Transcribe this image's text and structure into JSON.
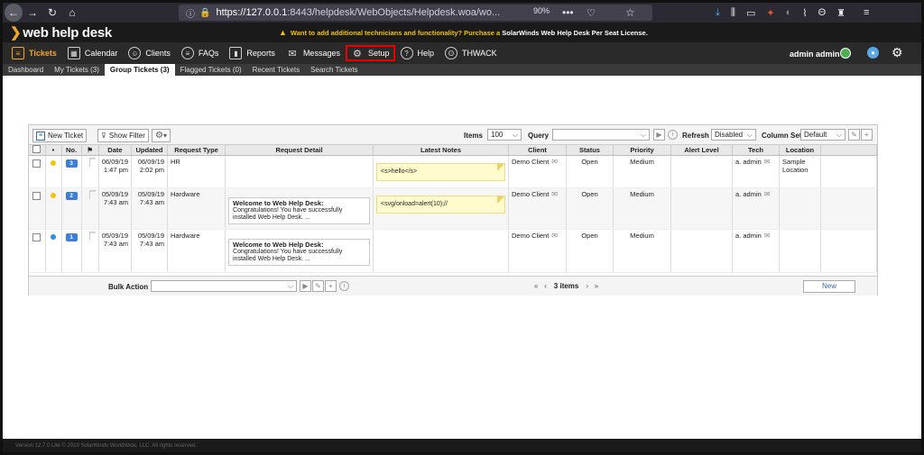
{
  "browser": {
    "url_host": "https://127.0.0.1",
    "url_rest": ":8443/helpdesk/WebObjects/Helpdesk.woa/wo...",
    "zoom": "90%"
  },
  "app": {
    "logo": "web help desk",
    "promo_text": "Want to add additional technicians and functionality? Purchase a",
    "promo_strong": "SolarWinds Web Help Desk Per Seat License."
  },
  "main_nav": {
    "items": [
      {
        "label": "Tickets",
        "icon": "list-icon"
      },
      {
        "label": "Calendar",
        "icon": "calendar-icon"
      },
      {
        "label": "Clients",
        "icon": "person-icon"
      },
      {
        "label": "FAQs",
        "icon": "faq-icon"
      },
      {
        "label": "Reports",
        "icon": "chart-icon"
      },
      {
        "label": "Messages",
        "icon": "mail-icon"
      },
      {
        "label": "Setup",
        "icon": "gear-icon"
      },
      {
        "label": "Help",
        "icon": "help-icon"
      },
      {
        "label": "THWACK",
        "icon": "thwack-icon"
      }
    ],
    "admin_label": "admin admin"
  },
  "sub_nav": {
    "tabs": [
      "Dashboard",
      "My Tickets (3)",
      "Group Tickets (3)",
      "Flagged Tickets (0)",
      "Recent Tickets",
      "Search Tickets"
    ]
  },
  "toolbar": {
    "new_ticket": "New Ticket",
    "show_filter": "Show Filter",
    "items_label": "Items",
    "items_value": "100",
    "query_label": "Query",
    "refresh_label": "Refresh",
    "refresh_value": "Disabled",
    "column_set_label": "Column Set",
    "column_set_value": "Default"
  },
  "table": {
    "headers": [
      "",
      "•",
      "No.",
      "⚑",
      "Date",
      "Updated",
      "Request Type",
      "Request Detail",
      "Latest Notes",
      "Client",
      "Status",
      "Priority",
      "Alert Level",
      "Tech",
      "Location"
    ],
    "rows": [
      {
        "dot_color": "#f5c400",
        "no": "3",
        "date": "06/09/19",
        "date_time": "1:47 pm",
        "updated": "06/09/19",
        "updated_time": "2:02 pm",
        "type": "HR",
        "detail_title": "",
        "detail_body": "",
        "note": "<s>hello</s>",
        "client": "Demo Client",
        "status": "Open",
        "priority": "Medium",
        "alert": "",
        "tech": "a. admin",
        "location": "Sample Location"
      },
      {
        "dot_color": "#f5c400",
        "no": "2",
        "date": "05/09/19",
        "date_time": "7:43 am",
        "updated": "05/09/19",
        "updated_time": "7:43 am",
        "type": "Hardware",
        "detail_title": "Welcome to Web Help Desk:",
        "detail_body": "Congratulations! You have successfully installed Web Help Desk. ...",
        "note": "<svg/onload=alert(10);//",
        "client": "Demo Client",
        "status": "Open",
        "priority": "Medium",
        "alert": "",
        "tech": "a. admin",
        "location": ""
      },
      {
        "dot_color": "#2f8ee0",
        "no": "1",
        "date": "05/09/19",
        "date_time": "7:43 am",
        "updated": "05/09/19",
        "updated_time": "7:43 am",
        "type": "Hardware",
        "detail_title": "Welcome to Web Help Desk:",
        "detail_body": "Congratulations! You have successfully installed Web Help Desk. ...",
        "note": "",
        "client": "Demo Client",
        "status": "Open",
        "priority": "Medium",
        "alert": "",
        "tech": "a. admin",
        "location": ""
      }
    ]
  },
  "footer": {
    "bulk_action": "Bulk Action",
    "items_count": "3 items",
    "new_button": "New"
  },
  "bottom": {
    "copyright": "Version 12.7.0 Lite © 2019 SolarWinds WorldWide, LLC. All rights reserved."
  }
}
